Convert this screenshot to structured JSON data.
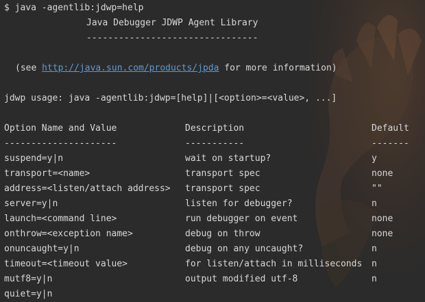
{
  "prompt": "$ java -agentlib:jdwp=help",
  "header_title": "Java Debugger JDWP Agent Library",
  "header_rule": "--------------------------------",
  "see_prefix": "(see ",
  "see_link": "http://java.sun.com/products/jpda",
  "see_suffix": " for more information)",
  "usage": "jdwp usage: java -agentlib:jdwp=[help]|[<option>=<value>, ...]",
  "table": {
    "headers": [
      "Option Name and Value",
      "Description",
      "Default"
    ],
    "rules": [
      "---------------------",
      "-----------",
      "-------"
    ],
    "rows": [
      {
        "option": "suspend=y|n",
        "description": "wait on startup?",
        "default": "y"
      },
      {
        "option": "transport=<name>",
        "description": "transport spec",
        "default": "none"
      },
      {
        "option": "address=<listen/attach address>",
        "description": "transport spec",
        "default": "\"\""
      },
      {
        "option": "server=y|n",
        "description": "listen for debugger?",
        "default": "n"
      },
      {
        "option": "launch=<command line>",
        "description": "run debugger on event",
        "default": "none"
      },
      {
        "option": "onthrow=<exception name>",
        "description": "debug on throw",
        "default": "none"
      },
      {
        "option": "onuncaught=y|n",
        "description": "debug on any uncaught?",
        "default": "n"
      },
      {
        "option": "timeout=<timeout value>",
        "description": "for listen/attach in milliseconds",
        "default": "n"
      },
      {
        "option": "mutf8=y|n",
        "description": "output modified utf-8",
        "default": "n"
      },
      {
        "option": "quiet=y|n",
        "description": "",
        "default": ""
      }
    ]
  },
  "colors": {
    "background": "#2b2b2b",
    "text": "#d8d8d8",
    "link": "#5b9bd5"
  },
  "icons": {
    "background_art": "hand-illustration"
  }
}
